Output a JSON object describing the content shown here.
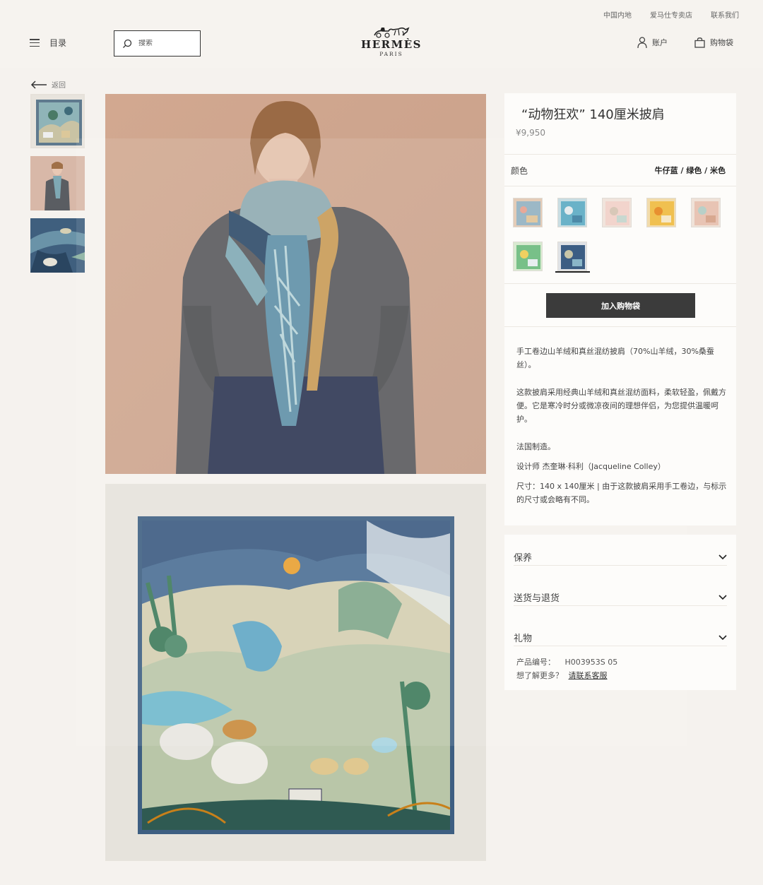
{
  "header": {
    "top_links": [
      "中国内地",
      "爱马仕专卖店",
      "联系我们"
    ],
    "menu_label": "目录",
    "search_placeholder": "搜索",
    "logo_main": "HERMÈS",
    "logo_sub": "PARIS",
    "account_label": "账户",
    "bag_label": "购物袋"
  },
  "nav": {
    "back_label": "返回"
  },
  "product": {
    "title": "“动物狂欢” 140厘米披肩",
    "price": "¥9,950",
    "color_label": "颜色",
    "color_value": "牛仔蓝 / 绿色 / 米色",
    "swatch_count_selected_index": 6,
    "add_to_bag": "加入购物袋",
    "description": [
      "手工卷边山羊绒和真丝混纺披肩（70%山羊绒，30%桑蚕丝）。",
      "这款披肩采用经典山羊绒和真丝混纺面料，柔软轻盈，佩戴方便。它是寒冷时分或微凉夜间的理想伴侣，为您提供温暖呵护。",
      "法国制造。",
      "设计师 杰奎琳·科利（Jacqueline Colley）",
      "尺寸：140 x 140厘米 | 由于这款披肩采用手工卷边，与标示的尺寸或会略有不同。"
    ]
  },
  "accordion": [
    {
      "label": "保养"
    },
    {
      "label": "送货与退货"
    },
    {
      "label": "礼物"
    }
  ],
  "meta": {
    "product_code_label": "产品编号：",
    "product_code": "H003953S 05",
    "more_label": "想了解更多？",
    "contact_link": "请联系客服"
  },
  "colors": {
    "accent": "#3b3b3b",
    "background": "#f5f2ee",
    "panel": "#fdfcfa"
  }
}
